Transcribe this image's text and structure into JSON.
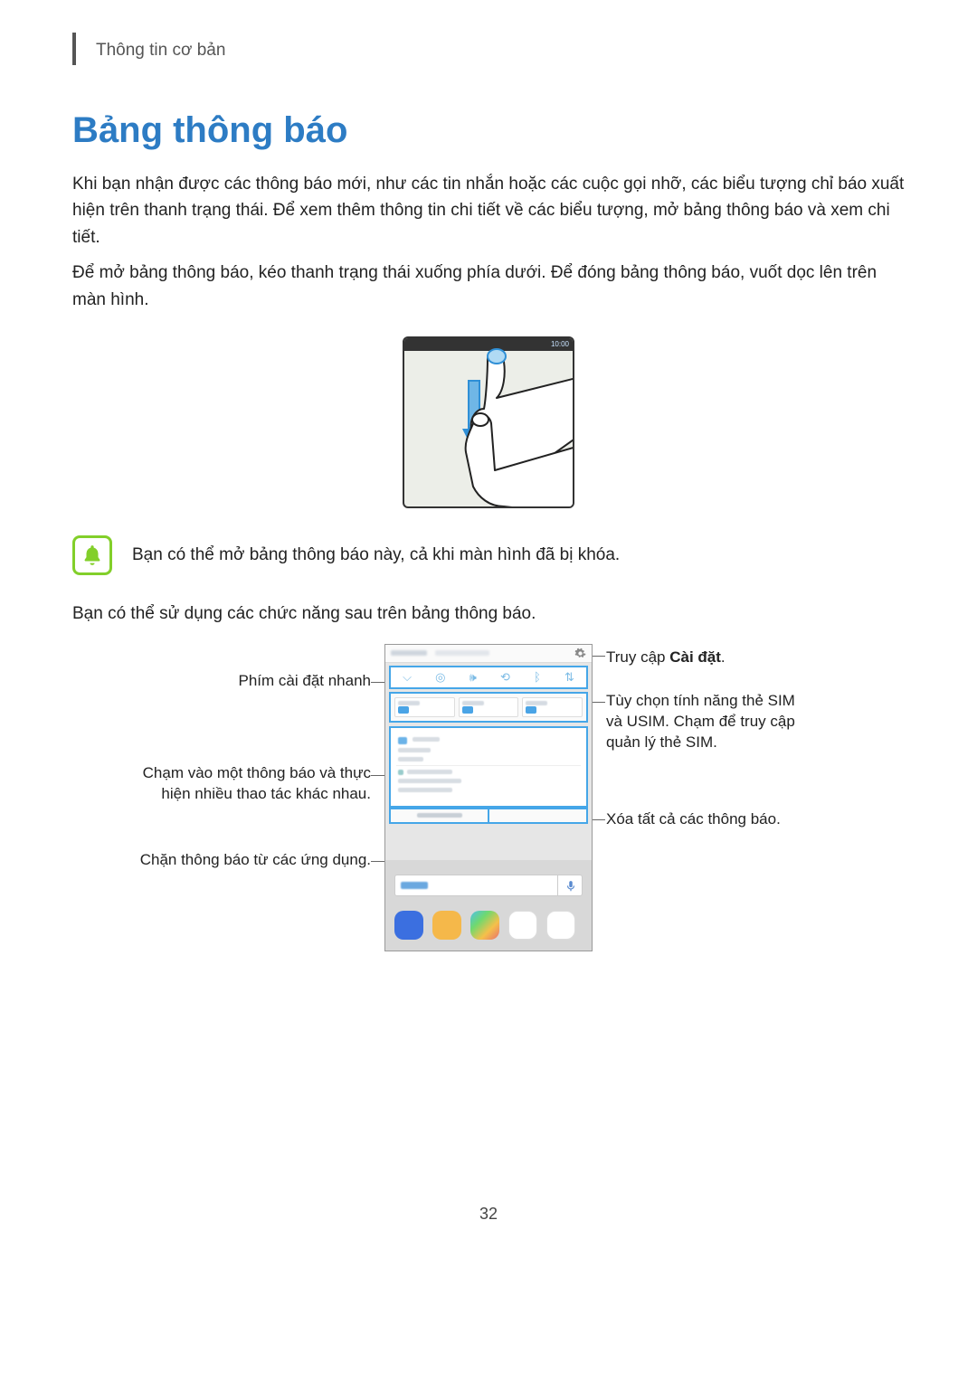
{
  "header": {
    "section": "Thông tin cơ bản"
  },
  "title": "Bảng thông báo",
  "paragraphs": {
    "p1": "Khi bạn nhận được các thông báo mới, như các tin nhắn hoặc các cuộc gọi nhỡ, các biểu tượng chỉ báo xuất hiện trên thanh trạng thái. Để xem thêm thông tin chi tiết về các biểu tượng, mở bảng thông báo và xem chi tiết.",
    "p2": "Để mở bảng thông báo, kéo thanh trạng thái xuống phía dưới. Để đóng bảng thông báo, vuốt dọc lên trên màn hình.",
    "note": "Bạn có thể mở bảng thông báo này, cả khi màn hình đã bị khóa.",
    "p3": "Bạn có thể sử dụng các chức năng sau trên bảng thông báo."
  },
  "gesture": {
    "time": "10:00"
  },
  "callouts": {
    "quick_settings": "Phím cài đặt nhanh",
    "tap_notification": "Chạm vào một thông báo và thực hiện nhiều thao tác khác nhau.",
    "block_apps": "Chặn thông báo từ các ứng dụng.",
    "settings_prefix": "Truy cập ",
    "settings_bold": "Cài đặt",
    "settings_suffix": ".",
    "sim": "Tùy chọn tính năng thẻ SIM và USIM. Chạm để truy cập quản lý thẻ SIM.",
    "clear_all": "Xóa tất cả các thông báo."
  },
  "page_number": "32"
}
